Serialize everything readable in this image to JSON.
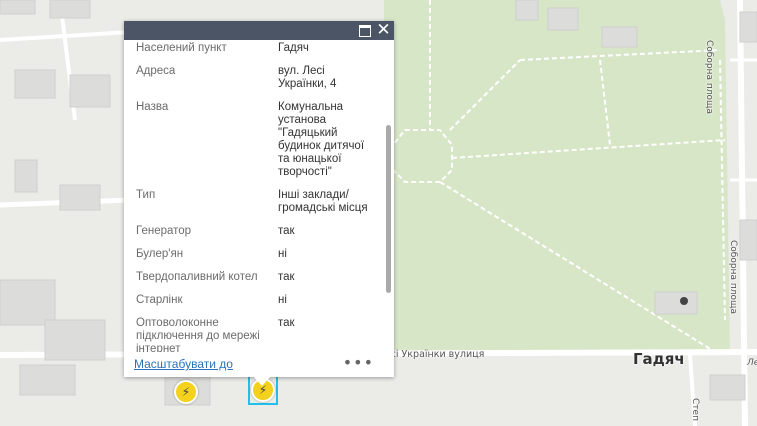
{
  "map": {
    "city_label": "Гадяч",
    "street_horizontal": "ісі Українки вулиця",
    "street_vertical_1": "Соборна площа",
    "street_vertical_2": "Соборна площа",
    "street_cut_1": "Ле",
    "street_cut_2": "Степ",
    "marker_icon": "lightning-icon",
    "marker_color": "#f3d11c",
    "park_color": "#d8e6c8",
    "selection_color": "#22c0e8"
  },
  "popup": {
    "header_color": "#4c5566",
    "rows": [
      {
        "key": "Населений пункт",
        "value": "Гадяч"
      },
      {
        "key": "Адреса",
        "value": "вул. Лесі Українки, 4"
      },
      {
        "key": "Назва",
        "value": "Комунальна установа \"Гадяцький будинок дитячої та юнацької творчості\""
      },
      {
        "key": "Тип",
        "value": "Інші заклади/ громадські місця"
      },
      {
        "key": "Генератор",
        "value": "так"
      },
      {
        "key": "Булер'ян",
        "value": "ні"
      },
      {
        "key": "Твердопаливний котел",
        "value": "так"
      },
      {
        "key": "Старлінк",
        "value": "ні"
      },
      {
        "key": "Оптоволоконне підключення до мережі інтернет",
        "value": "так"
      }
    ],
    "zoom_link": "Масштабувати до",
    "more_label": "•••",
    "maximize_icon": "maximize-icon",
    "close_icon": "close-icon"
  }
}
